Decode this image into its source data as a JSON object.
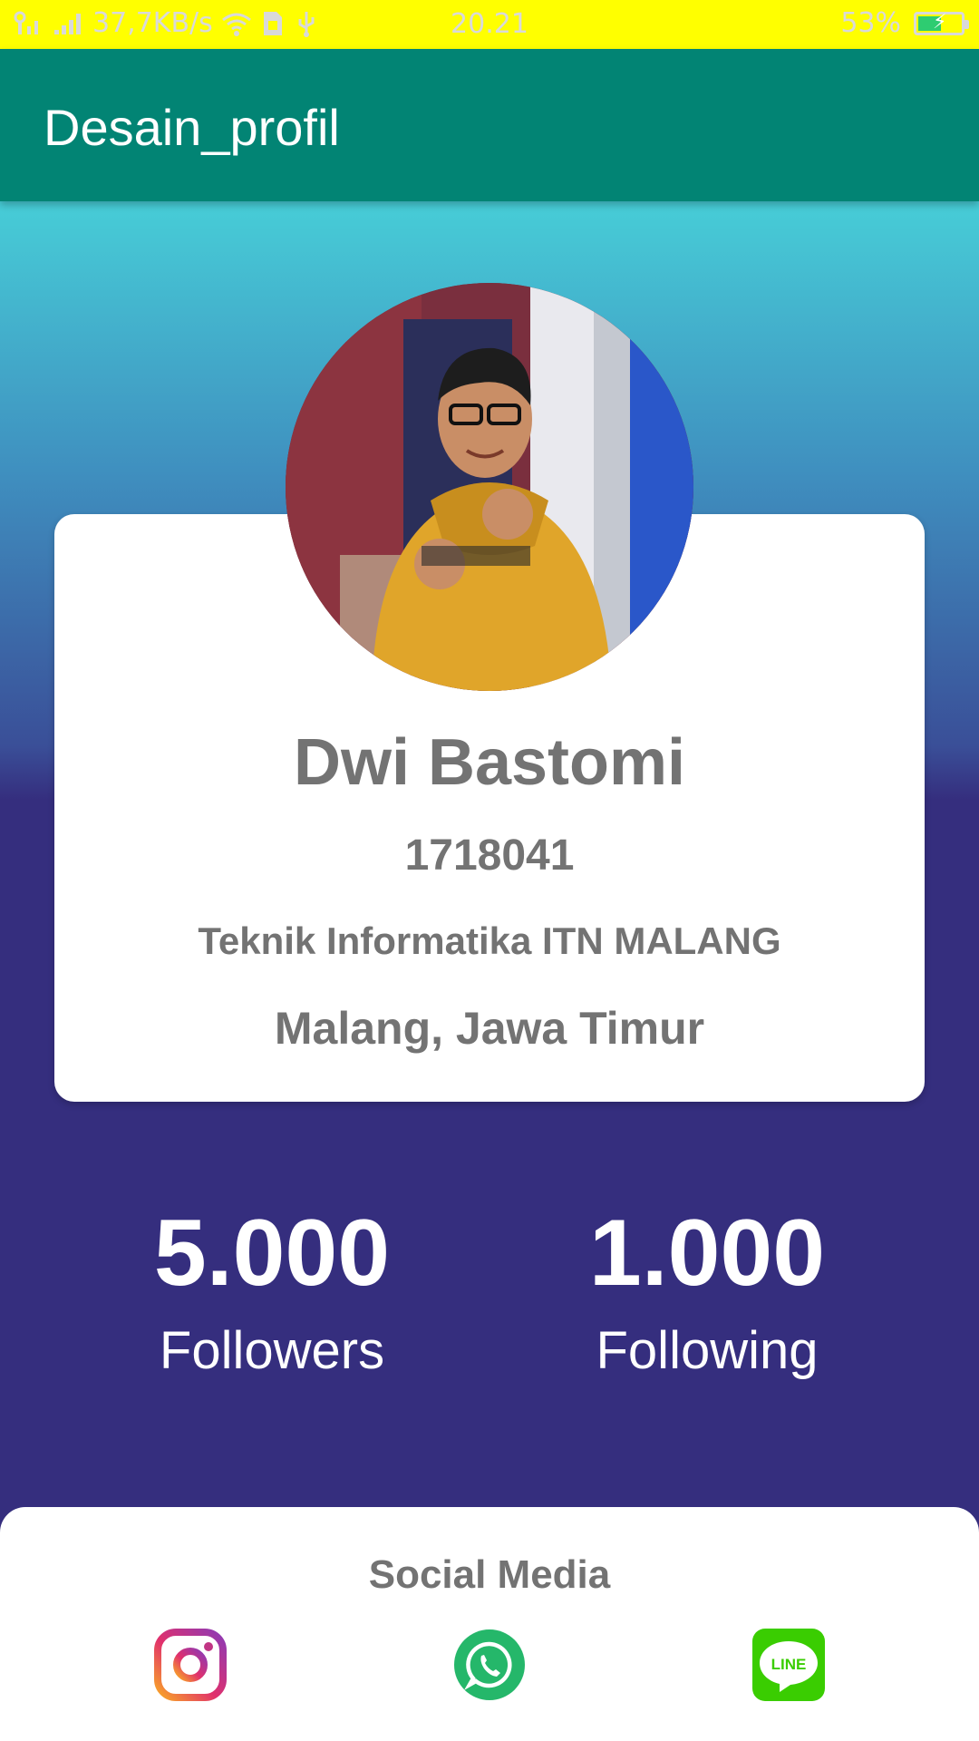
{
  "status_bar": {
    "network_speed": "37,7KB/s",
    "time": "20.21",
    "battery": "53%",
    "battery_level": 0.53,
    "icons": [
      "sim-signal-icon",
      "signal-icon",
      "wifi-icon",
      "sim-card-icon",
      "usb-icon",
      "battery-charging-icon"
    ]
  },
  "app_bar": {
    "title": "Desain_profil"
  },
  "profile": {
    "name": "Dwi Bastomi",
    "nim": "1718041",
    "department": "Teknik Informatika ITN MALANG",
    "location": "Malang, Jawa Timur"
  },
  "stats": {
    "followers": {
      "value": "5.000",
      "label": "Followers"
    },
    "following": {
      "value": "1.000",
      "label": "Following"
    }
  },
  "social": {
    "title": "Social Media",
    "items": [
      {
        "icon": "instagram-icon",
        "color": "#e1306c"
      },
      {
        "icon": "whatsapp-icon",
        "color": "#25b76a"
      },
      {
        "icon": "line-icon",
        "color": "#3acd01",
        "text": "LINE"
      }
    ]
  },
  "colors": {
    "status_bar": "#ffff00",
    "app_bar": "#028474",
    "gradient_top": "#47cdd7",
    "gradient_bottom": "#352e7e"
  }
}
